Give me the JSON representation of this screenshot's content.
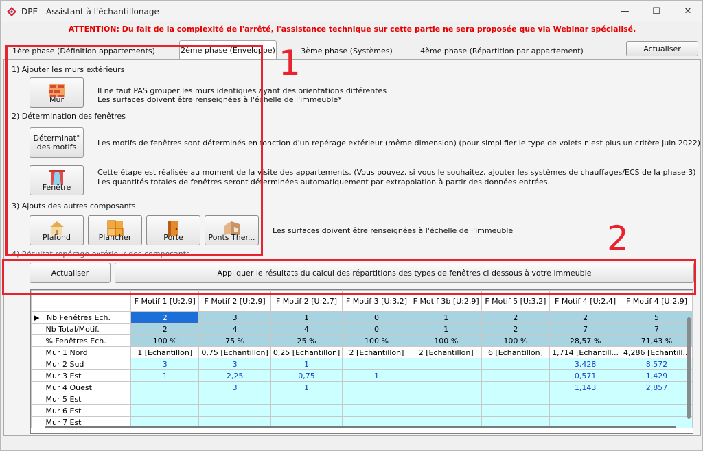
{
  "window": {
    "title": "DPE - Assistant à l'échantillonage",
    "minimize": "—",
    "maximize": "☐",
    "close": "✕"
  },
  "attention": "ATTENTION: Du fait de la complexité de l'arrêté, l'assistance technique sur cette partie ne sera proposée que via Webinar spécialisé.",
  "tabs": [
    "1ère phase (Définition appartements)",
    "2ème phase (Enveloppe)",
    "3ème phase (Systèmes)",
    "4ème phase (Répartition par appartement)"
  ],
  "actualiser_top": "Actualiser",
  "sections": {
    "s1": "1) Ajouter les murs extérieurs",
    "s2": "2) Détermination des fenêtres",
    "s3": "3) Ajouts des autres composants",
    "s4": "4) Résultat repérage extérieur des composants"
  },
  "buttons": {
    "mur": "Mur",
    "determ_line1": "Déterminat°",
    "determ_line2": "des motifs",
    "fenetre": "Fenêtre",
    "plafond": "Plafond",
    "plancher": "Plancher",
    "porte": "Porte",
    "ponts": "Ponts Ther..."
  },
  "notes": {
    "mur1": "Il ne faut PAS grouper les murs identiques ayant des orientations différentes",
    "mur2": "Les surfaces doivent être renseignées à l'échelle de l'immeuble*",
    "determ": "Les motifs de fenêtres sont déterminés en fonction d'un repérage extérieur (même dimension) (pour simplifier le type de volets n'est plus un critère juin 2022)",
    "fen1": "Cette étape est réalisée au moment de la visite des appartements. (Vous pouvez, si vous le souhaitez, ajouter les systèmes de chauffages/ECS de la phase 3)",
    "fen2": "Les quantités totales de fenêtres seront déterminées automatiquement par extrapolation à partir des données entrées.",
    "autres": "Les surfaces doivent être renseignées à l'échelle de l'immeuble"
  },
  "actualiser_bottom": "Actualiser",
  "appliquer": "Appliquer le résultats du calcul des répartitions des types de fenêtres ci dessous à votre immeuble",
  "annotations": {
    "n1": "1",
    "n2": "2"
  },
  "grid": {
    "columns": [
      "F Motif 1 [U:2,9]",
      "F Motif 2 [U:2,9]",
      "F Motif 2 [U:2,7]",
      "F Motif 3 [U:3,2]",
      "F Motif 3b [U:2.9]",
      "F Motif 5 [U:3,2]",
      "F Motif 4 [U:2,4]",
      "F Motif 4 [U:2,9]"
    ],
    "rows": [
      {
        "label": "Nb Fenêtres Ech.",
        "style": "blue",
        "values": [
          "2",
          "3",
          "1",
          "0",
          "1",
          "2",
          "2",
          "5"
        ]
      },
      {
        "label": "Nb Total/Motif.",
        "style": "blue",
        "values": [
          "2",
          "4",
          "4",
          "0",
          "1",
          "2",
          "7",
          "7"
        ]
      },
      {
        "label": "% Fenêtres Ech.",
        "style": "blue",
        "values": [
          "100 %",
          "75 %",
          "25 %",
          "100 %",
          "100 %",
          "100 %",
          "28,57 %",
          "71,43 %"
        ]
      },
      {
        "label": "Mur  1 Nord",
        "style": "wht",
        "values": [
          "1 [Echantillon]",
          "0,75 [Echantillon]",
          "0,25 [Echantillon]",
          "2 [Echantillon]",
          "2 [Echantillon]",
          "6 [Echantillon]",
          "1,714 [Echantill...",
          "4,286 [Echantill..."
        ]
      },
      {
        "label": "Mur  2 Sud",
        "style": "cyan",
        "values": [
          "3",
          "3",
          "1",
          "",
          "",
          "",
          "3,428",
          "8,572"
        ]
      },
      {
        "label": "Mur  3 Est",
        "style": "cyan",
        "values": [
          "1",
          "2,25",
          "0,75",
          "1",
          "",
          "",
          "0,571",
          "1,429"
        ]
      },
      {
        "label": "Mur  4 Ouest",
        "style": "cyan",
        "values": [
          "",
          "3",
          "1",
          "",
          "",
          "",
          "1,143",
          "2,857"
        ]
      },
      {
        "label": "Mur  5 Est",
        "style": "cyan",
        "values": [
          "",
          "",
          "",
          "",
          "",
          "",
          "",
          ""
        ]
      },
      {
        "label": "Mur  6 Est",
        "style": "cyan",
        "values": [
          "",
          "",
          "",
          "",
          "",
          "",
          "",
          ""
        ]
      },
      {
        "label": "Mur  7 Est",
        "style": "cyan",
        "values": [
          "",
          "",
          "",
          "",
          "",
          "",
          "",
          ""
        ]
      }
    ]
  }
}
